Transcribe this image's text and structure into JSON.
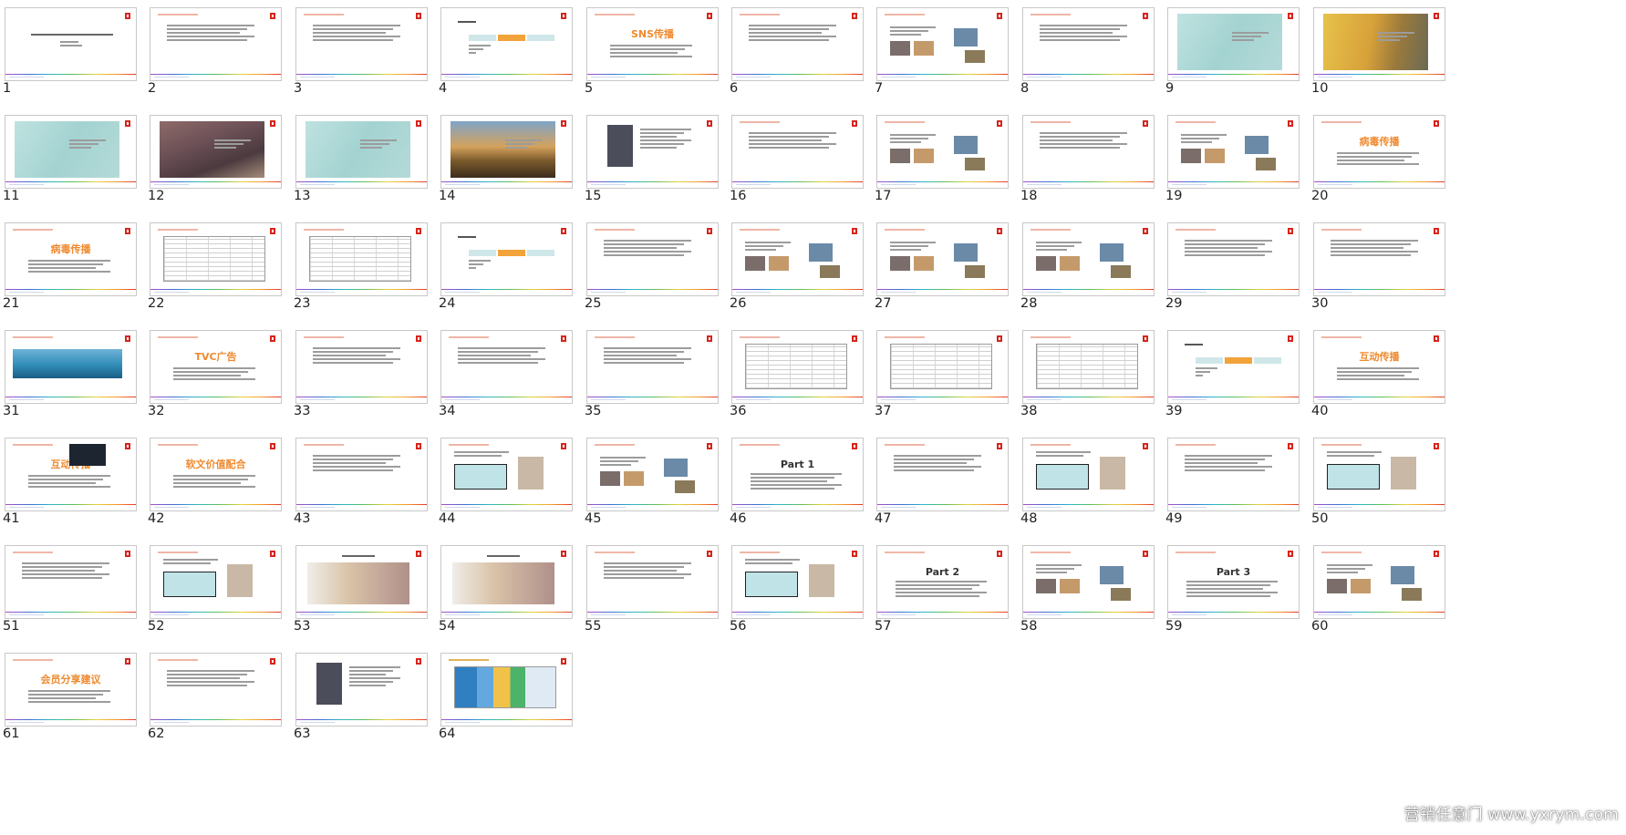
{
  "slides": [
    {
      "n": "1",
      "kind": "cover",
      "text": ""
    },
    {
      "n": "2",
      "kind": "text",
      "text": ""
    },
    {
      "n": "3",
      "kind": "text",
      "text": ""
    },
    {
      "n": "4",
      "kind": "flow",
      "text": ""
    },
    {
      "n": "5",
      "kind": "title",
      "text": "SNS传播"
    },
    {
      "n": "6",
      "kind": "text",
      "text": ""
    },
    {
      "n": "7",
      "kind": "photos",
      "text": ""
    },
    {
      "n": "8",
      "kind": "text",
      "text": ""
    },
    {
      "n": "9",
      "kind": "tealphoto",
      "text": ""
    },
    {
      "n": "10",
      "kind": "yellowphoto",
      "text": ""
    },
    {
      "n": "11",
      "kind": "tealphoto",
      "text": ""
    },
    {
      "n": "12",
      "kind": "mountain",
      "text": ""
    },
    {
      "n": "13",
      "kind": "tealphoto",
      "text": ""
    },
    {
      "n": "14",
      "kind": "sunset",
      "text": ""
    },
    {
      "n": "15",
      "kind": "photoleft",
      "text": ""
    },
    {
      "n": "16",
      "kind": "text",
      "text": ""
    },
    {
      "n": "17",
      "kind": "photos",
      "text": ""
    },
    {
      "n": "18",
      "kind": "text",
      "text": ""
    },
    {
      "n": "19",
      "kind": "photos",
      "text": ""
    },
    {
      "n": "20",
      "kind": "title",
      "text": "病毒传播"
    },
    {
      "n": "21",
      "kind": "title",
      "text": "病毒传播"
    },
    {
      "n": "22",
      "kind": "table",
      "text": ""
    },
    {
      "n": "23",
      "kind": "table",
      "text": ""
    },
    {
      "n": "24",
      "kind": "flow",
      "text": ""
    },
    {
      "n": "25",
      "kind": "text",
      "text": ""
    },
    {
      "n": "26",
      "kind": "photos",
      "text": ""
    },
    {
      "n": "27",
      "kind": "photos",
      "text": ""
    },
    {
      "n": "28",
      "kind": "photos",
      "text": ""
    },
    {
      "n": "29",
      "kind": "text",
      "text": ""
    },
    {
      "n": "30",
      "kind": "text",
      "text": ""
    },
    {
      "n": "31",
      "kind": "banner",
      "text": ""
    },
    {
      "n": "32",
      "kind": "title",
      "text": "TVC广告"
    },
    {
      "n": "33",
      "kind": "text",
      "text": ""
    },
    {
      "n": "34",
      "kind": "text",
      "text": ""
    },
    {
      "n": "35",
      "kind": "text",
      "text": ""
    },
    {
      "n": "36",
      "kind": "table",
      "text": ""
    },
    {
      "n": "37",
      "kind": "table",
      "text": ""
    },
    {
      "n": "38",
      "kind": "table",
      "text": ""
    },
    {
      "n": "39",
      "kind": "flow",
      "text": ""
    },
    {
      "n": "40",
      "kind": "title",
      "text": "互动传播"
    },
    {
      "n": "41",
      "kind": "title",
      "text": "互动传播"
    },
    {
      "n": "42",
      "kind": "title",
      "text": "软文价值配合"
    },
    {
      "n": "43",
      "kind": "text",
      "text": ""
    },
    {
      "n": "44",
      "kind": "boxphoto",
      "text": ""
    },
    {
      "n": "45",
      "kind": "photos",
      "text": ""
    },
    {
      "n": "46",
      "kind": "part",
      "text": "Part 1"
    },
    {
      "n": "47",
      "kind": "text",
      "text": ""
    },
    {
      "n": "48",
      "kind": "boxphoto",
      "text": ""
    },
    {
      "n": "49",
      "kind": "text",
      "text": ""
    },
    {
      "n": "50",
      "kind": "boxphoto",
      "text": ""
    },
    {
      "n": "51",
      "kind": "text",
      "text": ""
    },
    {
      "n": "52",
      "kind": "boxphoto",
      "text": ""
    },
    {
      "n": "53",
      "kind": "screen",
      "text": ""
    },
    {
      "n": "54",
      "kind": "screen",
      "text": ""
    },
    {
      "n": "55",
      "kind": "text",
      "text": ""
    },
    {
      "n": "56",
      "kind": "boxphoto",
      "text": ""
    },
    {
      "n": "57",
      "kind": "part",
      "text": "Part 2"
    },
    {
      "n": "58",
      "kind": "photos",
      "text": ""
    },
    {
      "n": "59",
      "kind": "part",
      "text": "Part 3"
    },
    {
      "n": "60",
      "kind": "photos",
      "text": ""
    },
    {
      "n": "61",
      "kind": "title",
      "text": "会员分享建议"
    },
    {
      "n": "62",
      "kind": "text",
      "text": ""
    },
    {
      "n": "63",
      "kind": "photoleft",
      "text": ""
    },
    {
      "n": "64",
      "kind": "gantt",
      "text": ""
    }
  ],
  "watermark": "营销任意门 www.yxrym.com",
  "colors": {
    "accent": "#ef8a2f",
    "logo": "#d8241c",
    "teal": "#a9d7d6",
    "border": "#c8c8c8"
  }
}
